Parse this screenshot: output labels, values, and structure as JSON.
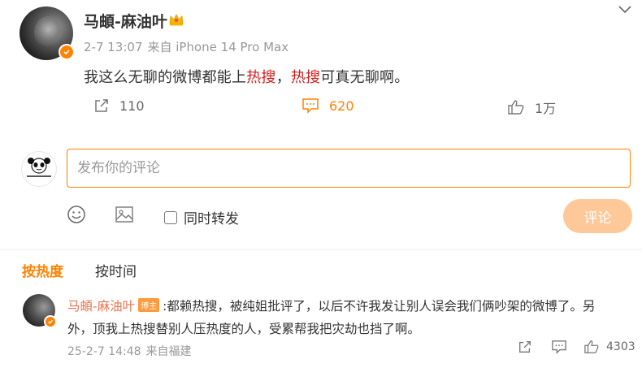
{
  "post": {
    "username": "马頔-麻油叶",
    "crown_icon": "crown-icon",
    "date": "2-7 13:07",
    "source": "来自 iPhone 14 Pro Max",
    "text_before": "我这么无聊的微博都能上",
    "highlight1": "热搜",
    "text_mid": "，",
    "highlight2": "热搜",
    "text_after": "可真无聊啊。",
    "reposts": "110",
    "comments": "620",
    "likes": "1万"
  },
  "composer": {
    "placeholder": "发布你的评论",
    "repost_label": "同时转发",
    "submit_label": "评论"
  },
  "sort": {
    "hot": "按热度",
    "time": "按时间"
  },
  "comment": {
    "username": "马頔-麻油叶",
    "badge": "博主",
    "text_line1": ":都赖热搜，被纯姐批评了，以后不许我发让别人误会我们俩吵架的微博了。另",
    "text_line2": "外，顶我上热搜替别人压热度的人，受累帮我把灾劫也挡了啊。",
    "date": "25-2-7 14:48",
    "source": "来自福建",
    "likes": "4303"
  },
  "colors": {
    "accent": "#ff8200",
    "hot_text": "#d31d1d",
    "comment_user": "#eb7350"
  }
}
